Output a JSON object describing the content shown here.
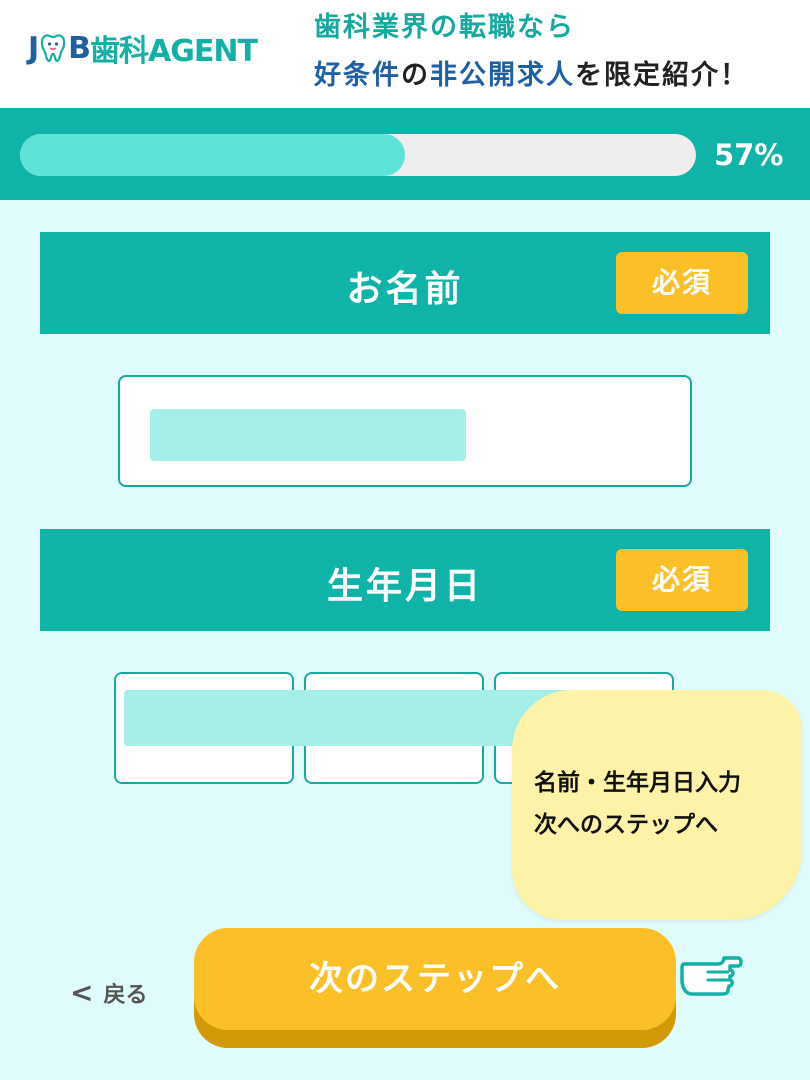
{
  "header": {
    "logo_j": "J",
    "logo_b": "B",
    "logo_rest": "歯科AGENT",
    "tagline_line1": "歯科業界の転職なら",
    "tagline_line2_a": "好条件",
    "tagline_line2_b": "の",
    "tagline_line2_c": "非公開求人",
    "tagline_line2_d": "を限定紹介！"
  },
  "progress": {
    "percent_text": "57%",
    "fraction": 0.57
  },
  "sections": {
    "name": {
      "title": "お名前",
      "badge": "必須"
    },
    "dob": {
      "title": "生年月日",
      "badge": "必須"
    }
  },
  "note": {
    "line1": "名前・生年月日入力",
    "line2": "次へのステップへ"
  },
  "footer": {
    "back_chevron": "<",
    "back_label": "戻る",
    "next_label": "次のステップへ"
  },
  "colors": {
    "brand_teal": "#0fb3a8",
    "brand_blue": "#1f5fa6",
    "badge_yellow": "#fbbf27",
    "progress_fill": "#5fe3d8"
  },
  "icons": {
    "logo_mark": "tooth-icon",
    "pointer": "pointing-hand-icon"
  }
}
